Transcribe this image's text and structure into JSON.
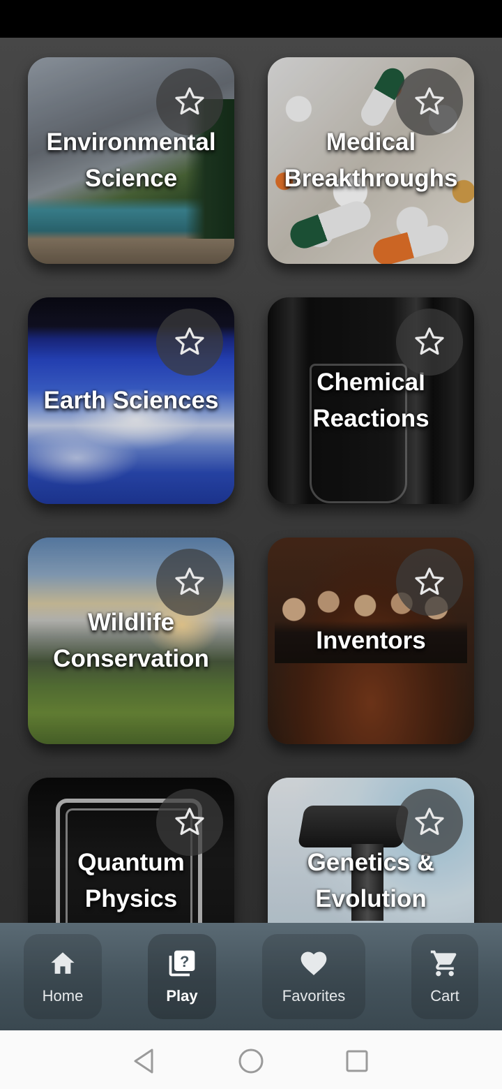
{
  "categories": [
    {
      "title": "Environmental Science",
      "favorite_icon": "star-outline-icon"
    },
    {
      "title": "Medical Breakthroughs",
      "favorite_icon": "star-outline-icon"
    },
    {
      "title": "Earth Sciences",
      "favorite_icon": "star-outline-icon"
    },
    {
      "title": "Chemical Reactions",
      "favorite_icon": "star-outline-icon"
    },
    {
      "title": "Wildlife Conservation",
      "favorite_icon": "star-outline-icon"
    },
    {
      "title": "Inventors",
      "favorite_icon": "star-outline-icon"
    },
    {
      "title": "Quantum Physics",
      "favorite_icon": "star-outline-icon"
    },
    {
      "title": "Genetics & Evolution",
      "favorite_icon": "star-outline-icon"
    }
  ],
  "bottom_nav": {
    "items": [
      {
        "label": "Home",
        "icon": "home-icon",
        "active": false
      },
      {
        "label": "Play",
        "icon": "quiz-icon",
        "active": true
      },
      {
        "label": "Favorites",
        "icon": "heart-icon",
        "active": false
      },
      {
        "label": "Cart",
        "icon": "cart-icon",
        "active": false
      }
    ]
  },
  "system_nav": {
    "buttons": [
      "back-icon",
      "home-circle-icon",
      "recents-icon"
    ]
  },
  "colors": {
    "background": "#3a3a3a",
    "nav_bar": "#4a5962",
    "nav_text": "#e6e9eb"
  }
}
